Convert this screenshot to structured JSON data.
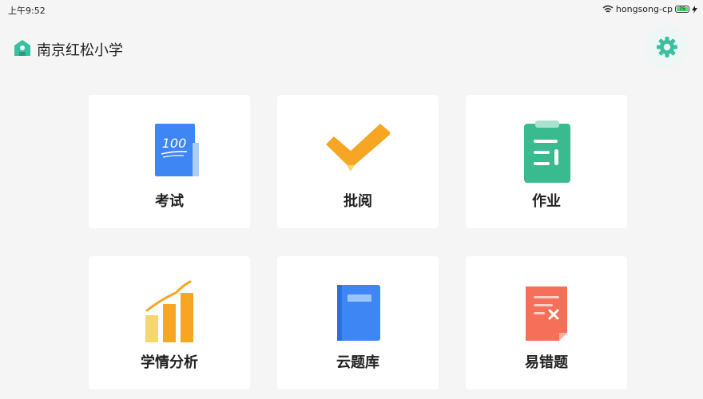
{
  "status_bar": {
    "time": "上午9:52",
    "network_name": "hongsong-cp",
    "battery_level": "75",
    "icons": [
      "wifi-icon",
      "battery-icon",
      "charging-icon"
    ]
  },
  "header": {
    "school_name": "南京红松小学",
    "school_icon": "school-house-icon",
    "settings_icon": "gear-icon"
  },
  "colors": {
    "accent": "#3bbfa3",
    "blue": "#3f86f5",
    "orange": "#f6a623",
    "green": "#3aba8f",
    "coral": "#f56f59"
  },
  "modules": [
    {
      "label": "考试",
      "icon": "exam-100-icon"
    },
    {
      "label": "批阅",
      "icon": "checkmark-icon"
    },
    {
      "label": "作业",
      "icon": "clipboard-icon"
    },
    {
      "label": "学情分析",
      "icon": "bar-chart-icon"
    },
    {
      "label": "云题库",
      "icon": "book-icon"
    },
    {
      "label": "易错题",
      "icon": "error-sheet-icon"
    }
  ],
  "exam_icon_text": "100"
}
